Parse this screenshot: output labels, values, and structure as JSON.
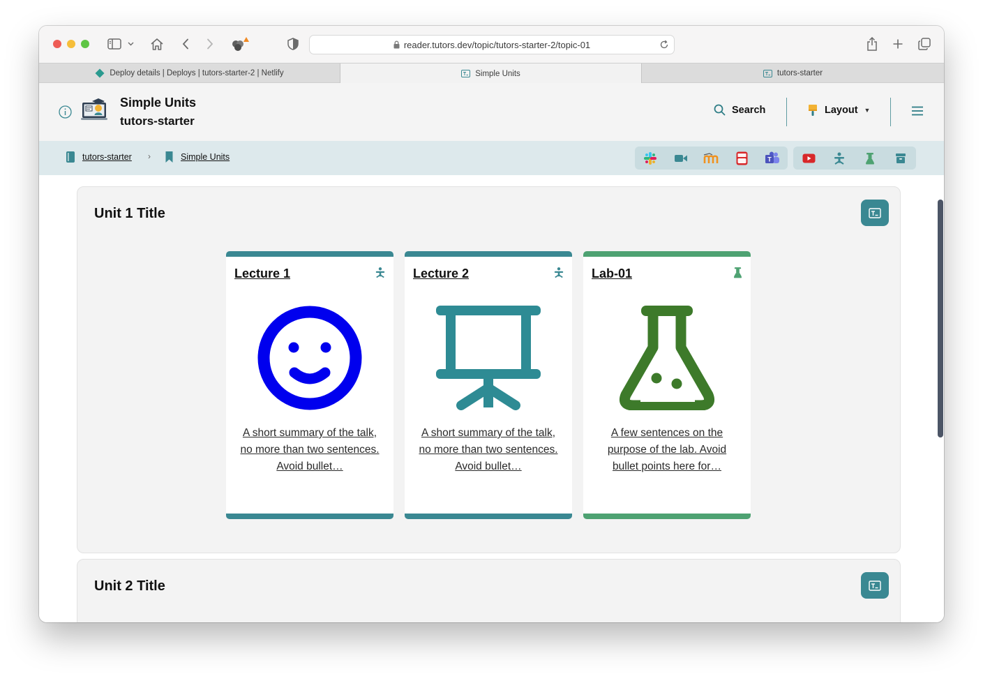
{
  "browser": {
    "url": "reader.tutors.dev/topic/tutors-starter-2/topic-01",
    "tabs": [
      {
        "label": "Deploy details | Deploys | tutors-starter-2 | Netlify"
      },
      {
        "label": "Simple Units"
      },
      {
        "label": "tutors-starter"
      }
    ]
  },
  "header": {
    "title": "Simple Units",
    "subtitle": "tutors-starter",
    "search_label": "Search",
    "layout_label": "Layout"
  },
  "breadcrumb": {
    "items": [
      {
        "label": "tutors-starter"
      },
      {
        "label": "Simple Units"
      }
    ],
    "separator": "›"
  },
  "units": [
    {
      "title": "Unit 1 Title",
      "cards": [
        {
          "title": "Lecture 1",
          "summary": "A short summary of the talk, no more than two sentences. Avoid bullet…",
          "accent": "#3a8892",
          "icon": "smiley-icon",
          "type_icon": "lecture-icon"
        },
        {
          "title": "Lecture 2",
          "summary": "A short summary of the talk, no more than two sentences. Avoid bullet…",
          "accent": "#3a8892",
          "icon": "presentation-icon",
          "type_icon": "lecture-icon"
        },
        {
          "title": "Lab-01",
          "summary": "A few sentences on the purpose of the lab. Avoid bullet points here for…",
          "accent": "#4ea272",
          "icon": "flask-icon",
          "type_icon": "lab-icon"
        }
      ]
    },
    {
      "title": "Unit 2 Title",
      "cards": []
    }
  ],
  "colors": {
    "brand": "#3a8892",
    "lab": "#4ea272",
    "smiley": "#0000ee",
    "presentation": "#2e8b94",
    "flask": "#3d7a2a"
  }
}
